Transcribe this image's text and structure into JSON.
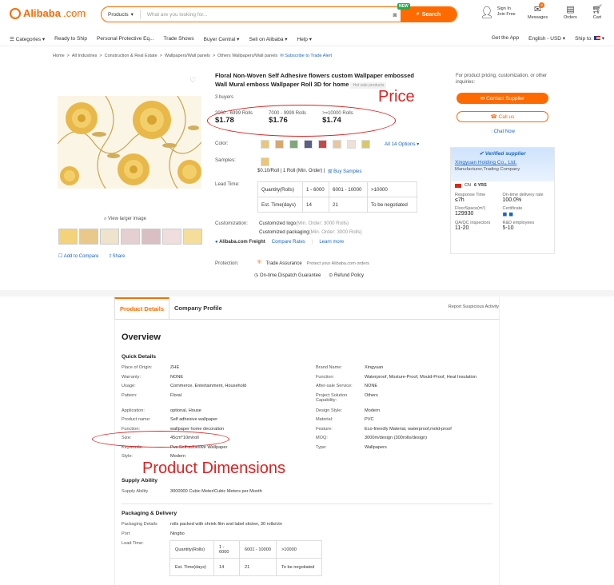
{
  "header": {
    "logo_text": "Alibaba",
    "logo_suffix": ".com",
    "search_category": "Products",
    "search_placeholder": "What are you looking for...",
    "search_button": "Search",
    "new_badge": "NEW",
    "sign_in": "Sign In",
    "join_free": "Join Free",
    "messages_label": "Messages",
    "messages_count": "9",
    "orders_label": "Orders",
    "cart_label": "Cart"
  },
  "nav": {
    "items": [
      "Categories",
      "Ready to Ship",
      "Personal Protective Eq...",
      "Trade Shows",
      "Buyer Central",
      "Sell on Alibaba",
      "Help"
    ],
    "right": [
      "Get the App",
      "English - USD",
      "Ship to:"
    ]
  },
  "breadcrumb": {
    "items": [
      "Home",
      "All Industries",
      "Construction & Real Estate",
      "Wallpapers/Wall panels",
      "Others Wallpapers/Wall panels"
    ],
    "subscribe": "Subscribe to Trade Alert"
  },
  "product": {
    "title": "Floral Non-Woven Self Adhesive flowers custom Wallpaper embossed Wall Mural emboss Wallpaper Roll 3D for home",
    "hot_badge": "Hot sale products",
    "buyers": "3 buyers",
    "prices": [
      {
        "qty": "2000 - 6999 Rolls",
        "price": "$1.78"
      },
      {
        "qty": "7000 - 9999 Rolls",
        "price": "$1.76"
      },
      {
        "qty": ">=10000 Rolls",
        "price": "$1.74"
      }
    ],
    "color_label": "Color:",
    "more_options": "All 14 Options",
    "samples_label": "Samples:",
    "samples_text": "$0.10/Roll | 1 Roll (Min. Order) |",
    "buy_samples": "Buy Samples",
    "lead_label": "Lead Time:",
    "lead_table": [
      [
        "Quantity(Rolls)",
        "1 - 6000",
        "6001 - 10000",
        ">10000"
      ],
      [
        "Est. Time(days)",
        "14",
        "21",
        "To be negotiated"
      ]
    ],
    "customization_label": "Customization:",
    "custom_logo": "Customized logo",
    "custom_logo_min": "(Min. Order: 3000 Rolls)",
    "custom_pack": "Customized packaging",
    "custom_pack_min": "(Min. Order: 3000 Rolls)",
    "freight": "Alibaba.com Freight",
    "compare_rates": "Compare Rates",
    "learn_more": "Learn more",
    "protection_label": "Protection:",
    "trade_assurance": "Trade Assurance",
    "trade_assurance_desc": "Protect your Alibaba.com orders",
    "ontime": "On-time Dispatch Guarantee",
    "refund": "Refund Policy",
    "view_larger": "View larger image",
    "add_compare": "Add to Compare",
    "share": "Share"
  },
  "annotations": {
    "price": "Price",
    "dimensions": "Product Dimensions"
  },
  "sidebar": {
    "inquiry_text": "For product pricing, customization, or other inquiries:",
    "contact_supplier": "Contact Supplier",
    "call_us": "Call us",
    "chat_now": "Chat Now",
    "verified": "Verified supplier",
    "company": "Xingyuan Holding Co., Ltd.",
    "company_type": "Manufacturer,Trading Company",
    "country": "CN",
    "years": "6 YRS",
    "stats": [
      {
        "label": "Response Time",
        "value": "≤7h"
      },
      {
        "label": "On-time delivery rate",
        "value": "100.0%"
      },
      {
        "label": "FloorSpace(m²)",
        "value": "129930"
      },
      {
        "label": "Certificate",
        "value": ""
      },
      {
        "label": "QA/QC inspectors",
        "value": "11-20"
      },
      {
        "label": "R&D employees",
        "value": "5-10"
      }
    ]
  },
  "details": {
    "tab_details": "Product Details",
    "tab_company": "Company Profile",
    "report": "Report Suspicious Activity",
    "overview": "Overview",
    "quick_details": "Quick Details",
    "left": [
      [
        "Place of Origin:",
        "ZHE"
      ],
      [
        "Warranty:",
        "NONE"
      ],
      [
        "Usage:",
        "Commerce, Entertainment, Household"
      ],
      [
        "Pattern:",
        "Floral"
      ],
      [
        "Application:",
        "optional, House"
      ],
      [
        "Product name:",
        "Self adhesive wallpaper"
      ],
      [
        "Function:",
        "wallpaper home decoration"
      ],
      [
        "Size:",
        "45cm*10m/roll"
      ],
      [
        "Keywords:",
        "Pvc Self-adhesive Wallpaper"
      ],
      [
        "Style:",
        "Modern"
      ]
    ],
    "right": [
      [
        "Brand Name:",
        "Xingyuan"
      ],
      [
        "Function:",
        "Waterproof, Mosture-Proof, Mould-Proof, Heat Insulation"
      ],
      [
        "After-sale Service:",
        "NONE"
      ],
      [
        "Project Solution Capability:",
        "Others"
      ],
      [
        "Design Style:",
        "Modern"
      ],
      [
        "Material:",
        "PVC"
      ],
      [
        "Feature:",
        "Eco-friendly Material, waterproof,mold-proof"
      ],
      [
        "MOQ:",
        "3000m/design (300rolls/design)"
      ],
      [
        "Type:",
        "Wallpapers"
      ]
    ],
    "supply_title": "Supply Ability",
    "supply_label": "Supply Ability",
    "supply_value": "3000000 Cubic Meter/Cubic Meters per Month",
    "pack_title": "Packaging & Delivery",
    "pack_details_label": "Packaging Details",
    "pack_details": "rolls packed with shrink film and label sticker, 30 rolls/ctn",
    "port_label": "Port",
    "port": "Ningbo",
    "lead_label": "Lead Time:",
    "lead_table": [
      [
        "Quantity(Rolls)",
        "1 - 6000",
        "6001 - 10000",
        ">10000"
      ],
      [
        "Est. Time(days)",
        "14",
        "21",
        "To be negotiated"
      ]
    ]
  },
  "colors": {
    "accent": "#ff6a00",
    "link": "#1a66c4",
    "annotation": "#e02020"
  }
}
